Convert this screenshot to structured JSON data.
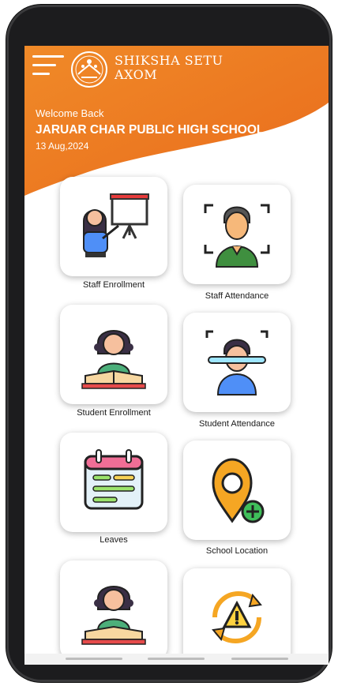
{
  "app": {
    "brand_line1": "SHIKSHA SETU",
    "brand_line2": "AXOM",
    "accent_color": "#ee7a22"
  },
  "header": {
    "welcome": "Welcome Back",
    "school_name": "JARUAR CHAR PUBLIC HIGH SCHOOL",
    "date": "13 Aug,2024"
  },
  "tiles": [
    {
      "label": "Staff Enrollment",
      "icon": "teacher-presentation-icon"
    },
    {
      "label": "Staff Attendance",
      "icon": "face-scan-icon"
    },
    {
      "label": "Student Enrollment",
      "icon": "student-reading-icon"
    },
    {
      "label": "Student Attendance",
      "icon": "face-scan-student-icon"
    },
    {
      "label": "Leaves",
      "icon": "calendar-icon"
    },
    {
      "label": "School Location",
      "icon": "location-add-icon"
    },
    {
      "label": "",
      "icon": "student-reading-icon"
    },
    {
      "label": "",
      "icon": "sync-warning-icon"
    }
  ]
}
